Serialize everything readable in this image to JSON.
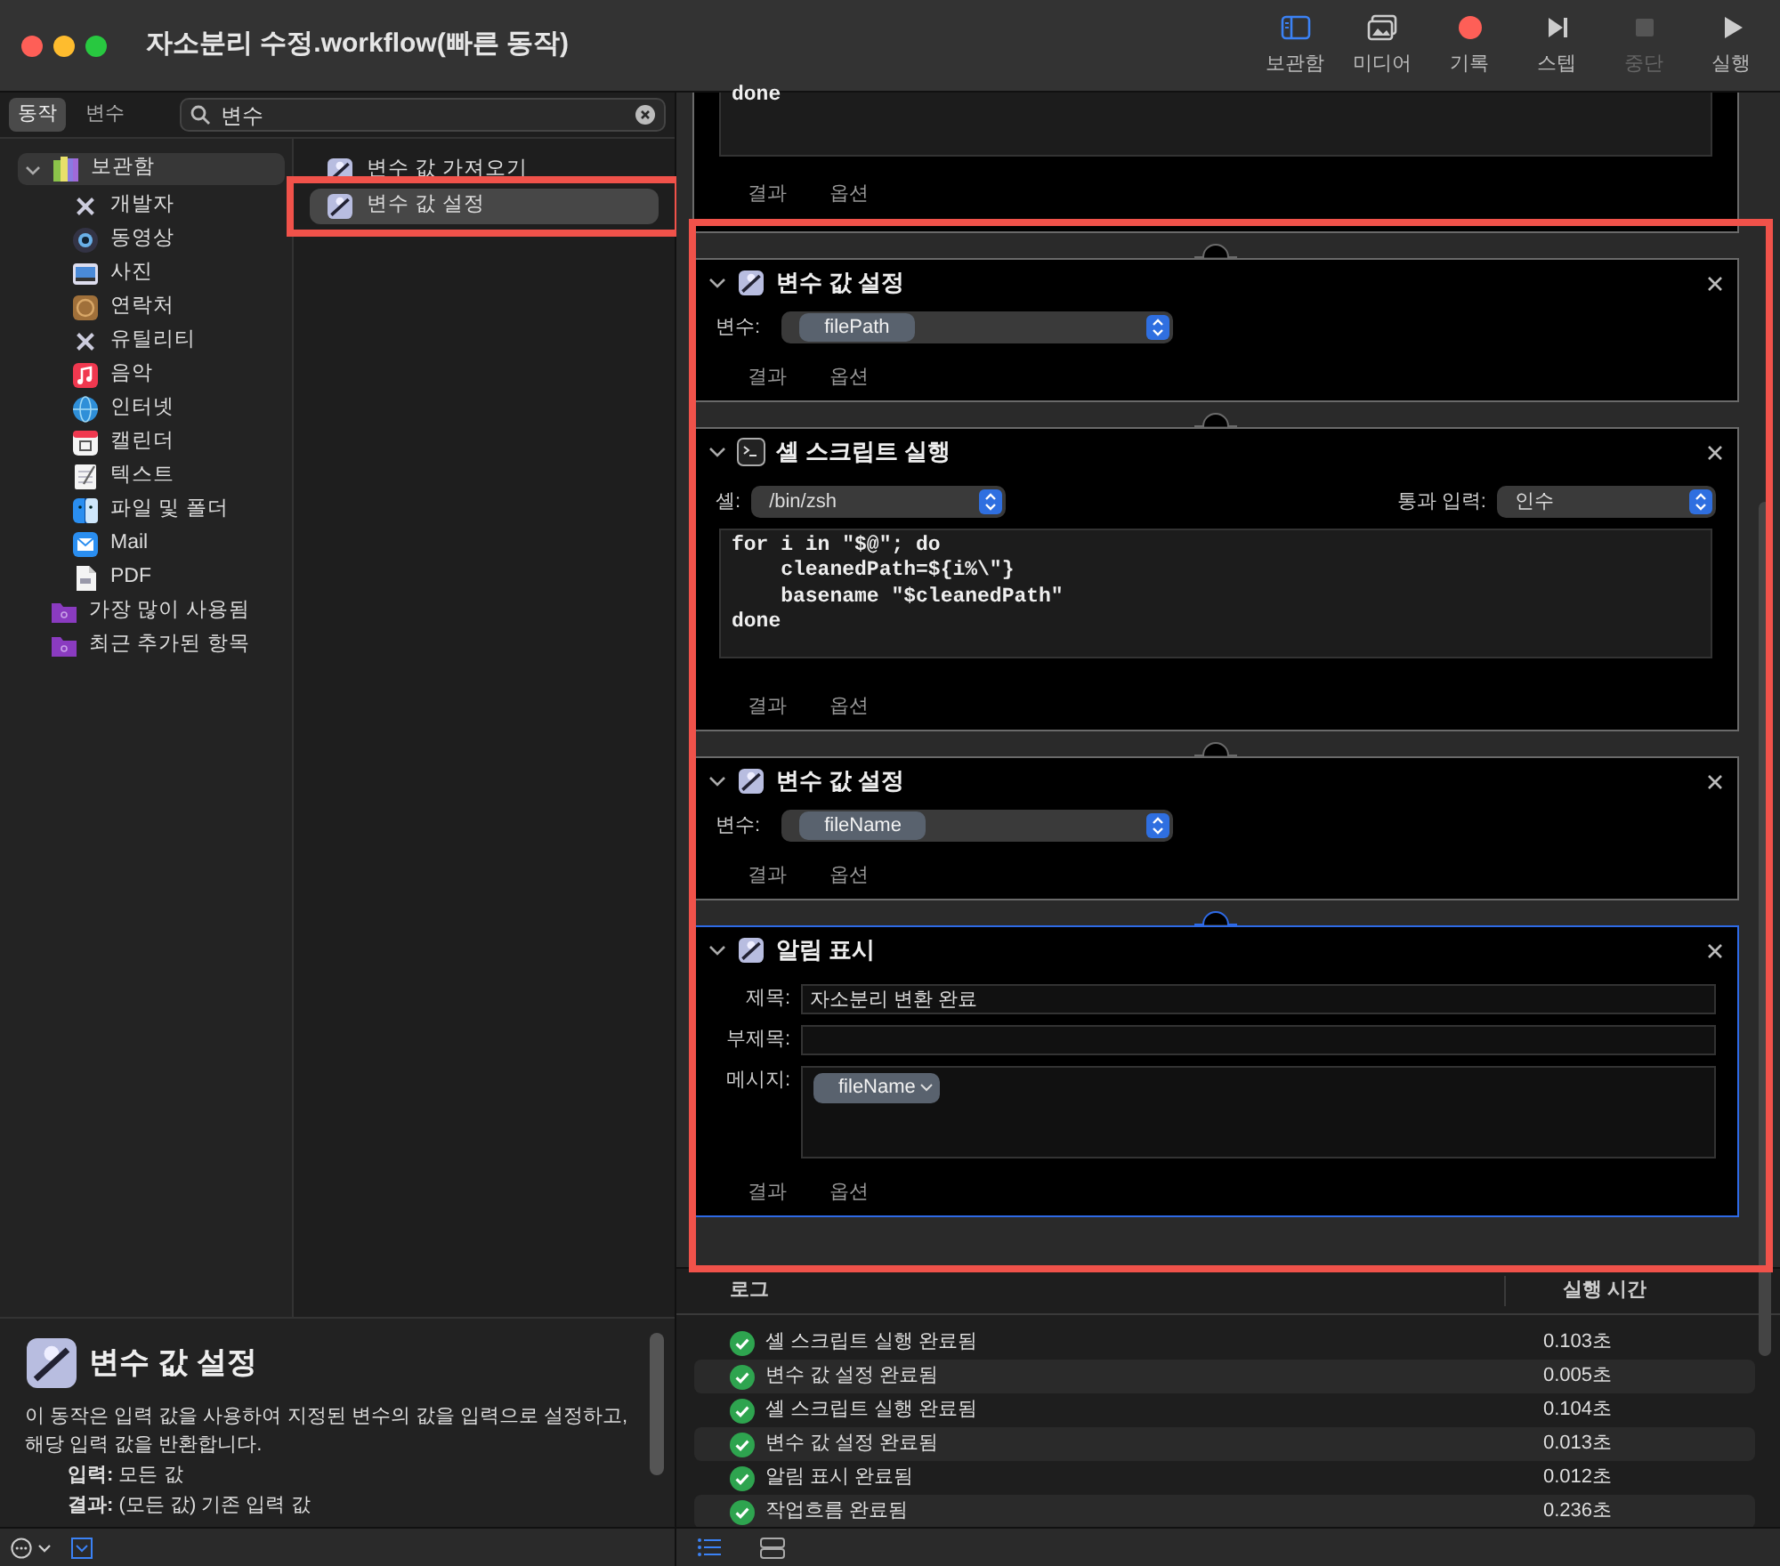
{
  "window": {
    "title": "자소분리 수정.workflow(빠른 동작)"
  },
  "toolbar": [
    {
      "label": "보관함",
      "kind": "library",
      "active": true,
      "disabled": false
    },
    {
      "label": "미디어",
      "kind": "media",
      "active": false,
      "disabled": false
    },
    {
      "label": "기록",
      "kind": "record",
      "active": false,
      "disabled": false
    },
    {
      "label": "스텝",
      "kind": "step",
      "active": false,
      "disabled": false
    },
    {
      "label": "중단",
      "kind": "stop",
      "active": false,
      "disabled": true
    },
    {
      "label": "실행",
      "kind": "run",
      "active": false,
      "disabled": false
    }
  ],
  "library_tabs": [
    {
      "label": "동작",
      "selected": true
    },
    {
      "label": "변수",
      "selected": false
    }
  ],
  "search": {
    "value": "변수"
  },
  "sidebar": {
    "items": [
      {
        "label": "보관함",
        "kind": "library",
        "expanded": true,
        "selected": true,
        "children": [
          {
            "label": "개발자",
            "kind": "tools"
          },
          {
            "label": "동영상",
            "kind": "video"
          },
          {
            "label": "사진",
            "kind": "photo"
          },
          {
            "label": "연락처",
            "kind": "contacts"
          },
          {
            "label": "유틸리티",
            "kind": "tools"
          },
          {
            "label": "음악",
            "kind": "music"
          },
          {
            "label": "인터넷",
            "kind": "internet"
          },
          {
            "label": "캘린더",
            "kind": "calendar"
          },
          {
            "label": "텍스트",
            "kind": "text"
          },
          {
            "label": "파일 및 폴더",
            "kind": "finder"
          },
          {
            "label": "Mail",
            "kind": "mail"
          },
          {
            "label": "PDF",
            "kind": "pdf"
          }
        ]
      },
      {
        "label": "가장 많이 사용됨",
        "kind": "folder",
        "selected": false
      },
      {
        "label": "최근 추가된 항목",
        "kind": "folder",
        "selected": false
      }
    ]
  },
  "actions": [
    {
      "label": "변수 값 가져오기",
      "selected": false,
      "highlighted": false
    },
    {
      "label": "변수 값 설정",
      "selected": true,
      "highlighted": true
    }
  ],
  "description": {
    "title": "변수 값 설정",
    "text": "이 동작은 입력 값을 사용하여 지정된 변수의 값을 입력으로 설정하고, 해당 입력 값을 반환합니다.",
    "input_label": "입력:",
    "input": "모든 값",
    "result_label": "결과:",
    "result": "(모든 값) 기존 입력 값"
  },
  "workflow": {
    "highlighted": true,
    "partial_card": {
      "code": [
        "done"
      ],
      "footer": [
        "결과",
        "옵션"
      ]
    },
    "cards": [
      {
        "kind": "set-variable",
        "title": "변수 값 설정",
        "selected": false,
        "field_label": "변수:",
        "value": "filePath",
        "footer": [
          "결과",
          "옵션"
        ]
      },
      {
        "kind": "shell",
        "title": "셸 스크립트 실행",
        "selected": false,
        "shell_label": "셸:",
        "shell": "/bin/zsh",
        "pass_label": "통과 입력:",
        "pass": "인수",
        "code": [
          "for i in \"$@\"; do",
          "    cleanedPath=${i%\\\"}",
          "    basename \"$cleanedPath\"",
          "done"
        ],
        "footer": [
          "결과",
          "옵션"
        ]
      },
      {
        "kind": "set-variable",
        "title": "변수 값 설정",
        "selected": false,
        "field_label": "변수:",
        "value": "fileName",
        "footer": [
          "결과",
          "옵션"
        ]
      },
      {
        "kind": "notification",
        "title": "알림 표시",
        "selected": true,
        "fields": [
          {
            "label": "제목:",
            "value": "자소분리 변환 완료"
          },
          {
            "label": "부제목:"
          }
        ],
        "message_label": "메시지:",
        "message_token": "fileName",
        "footer": [
          "결과",
          "옵션"
        ]
      }
    ]
  },
  "log": {
    "columns": [
      "로그",
      "실행 시간"
    ],
    "rows": [
      {
        "message": "셸 스크립트 실행 완료됨",
        "time": "0.103초"
      },
      {
        "message": "변수 값 설정 완료됨",
        "time": "0.005초"
      },
      {
        "message": "셸 스크립트 실행 완료됨",
        "time": "0.104초"
      },
      {
        "message": "변수 값 설정 완료됨",
        "time": "0.013초"
      },
      {
        "message": "알림 표시 완료됨",
        "time": "0.012초"
      },
      {
        "message": "작업흐름 완료됨",
        "time": "0.236초"
      }
    ]
  }
}
